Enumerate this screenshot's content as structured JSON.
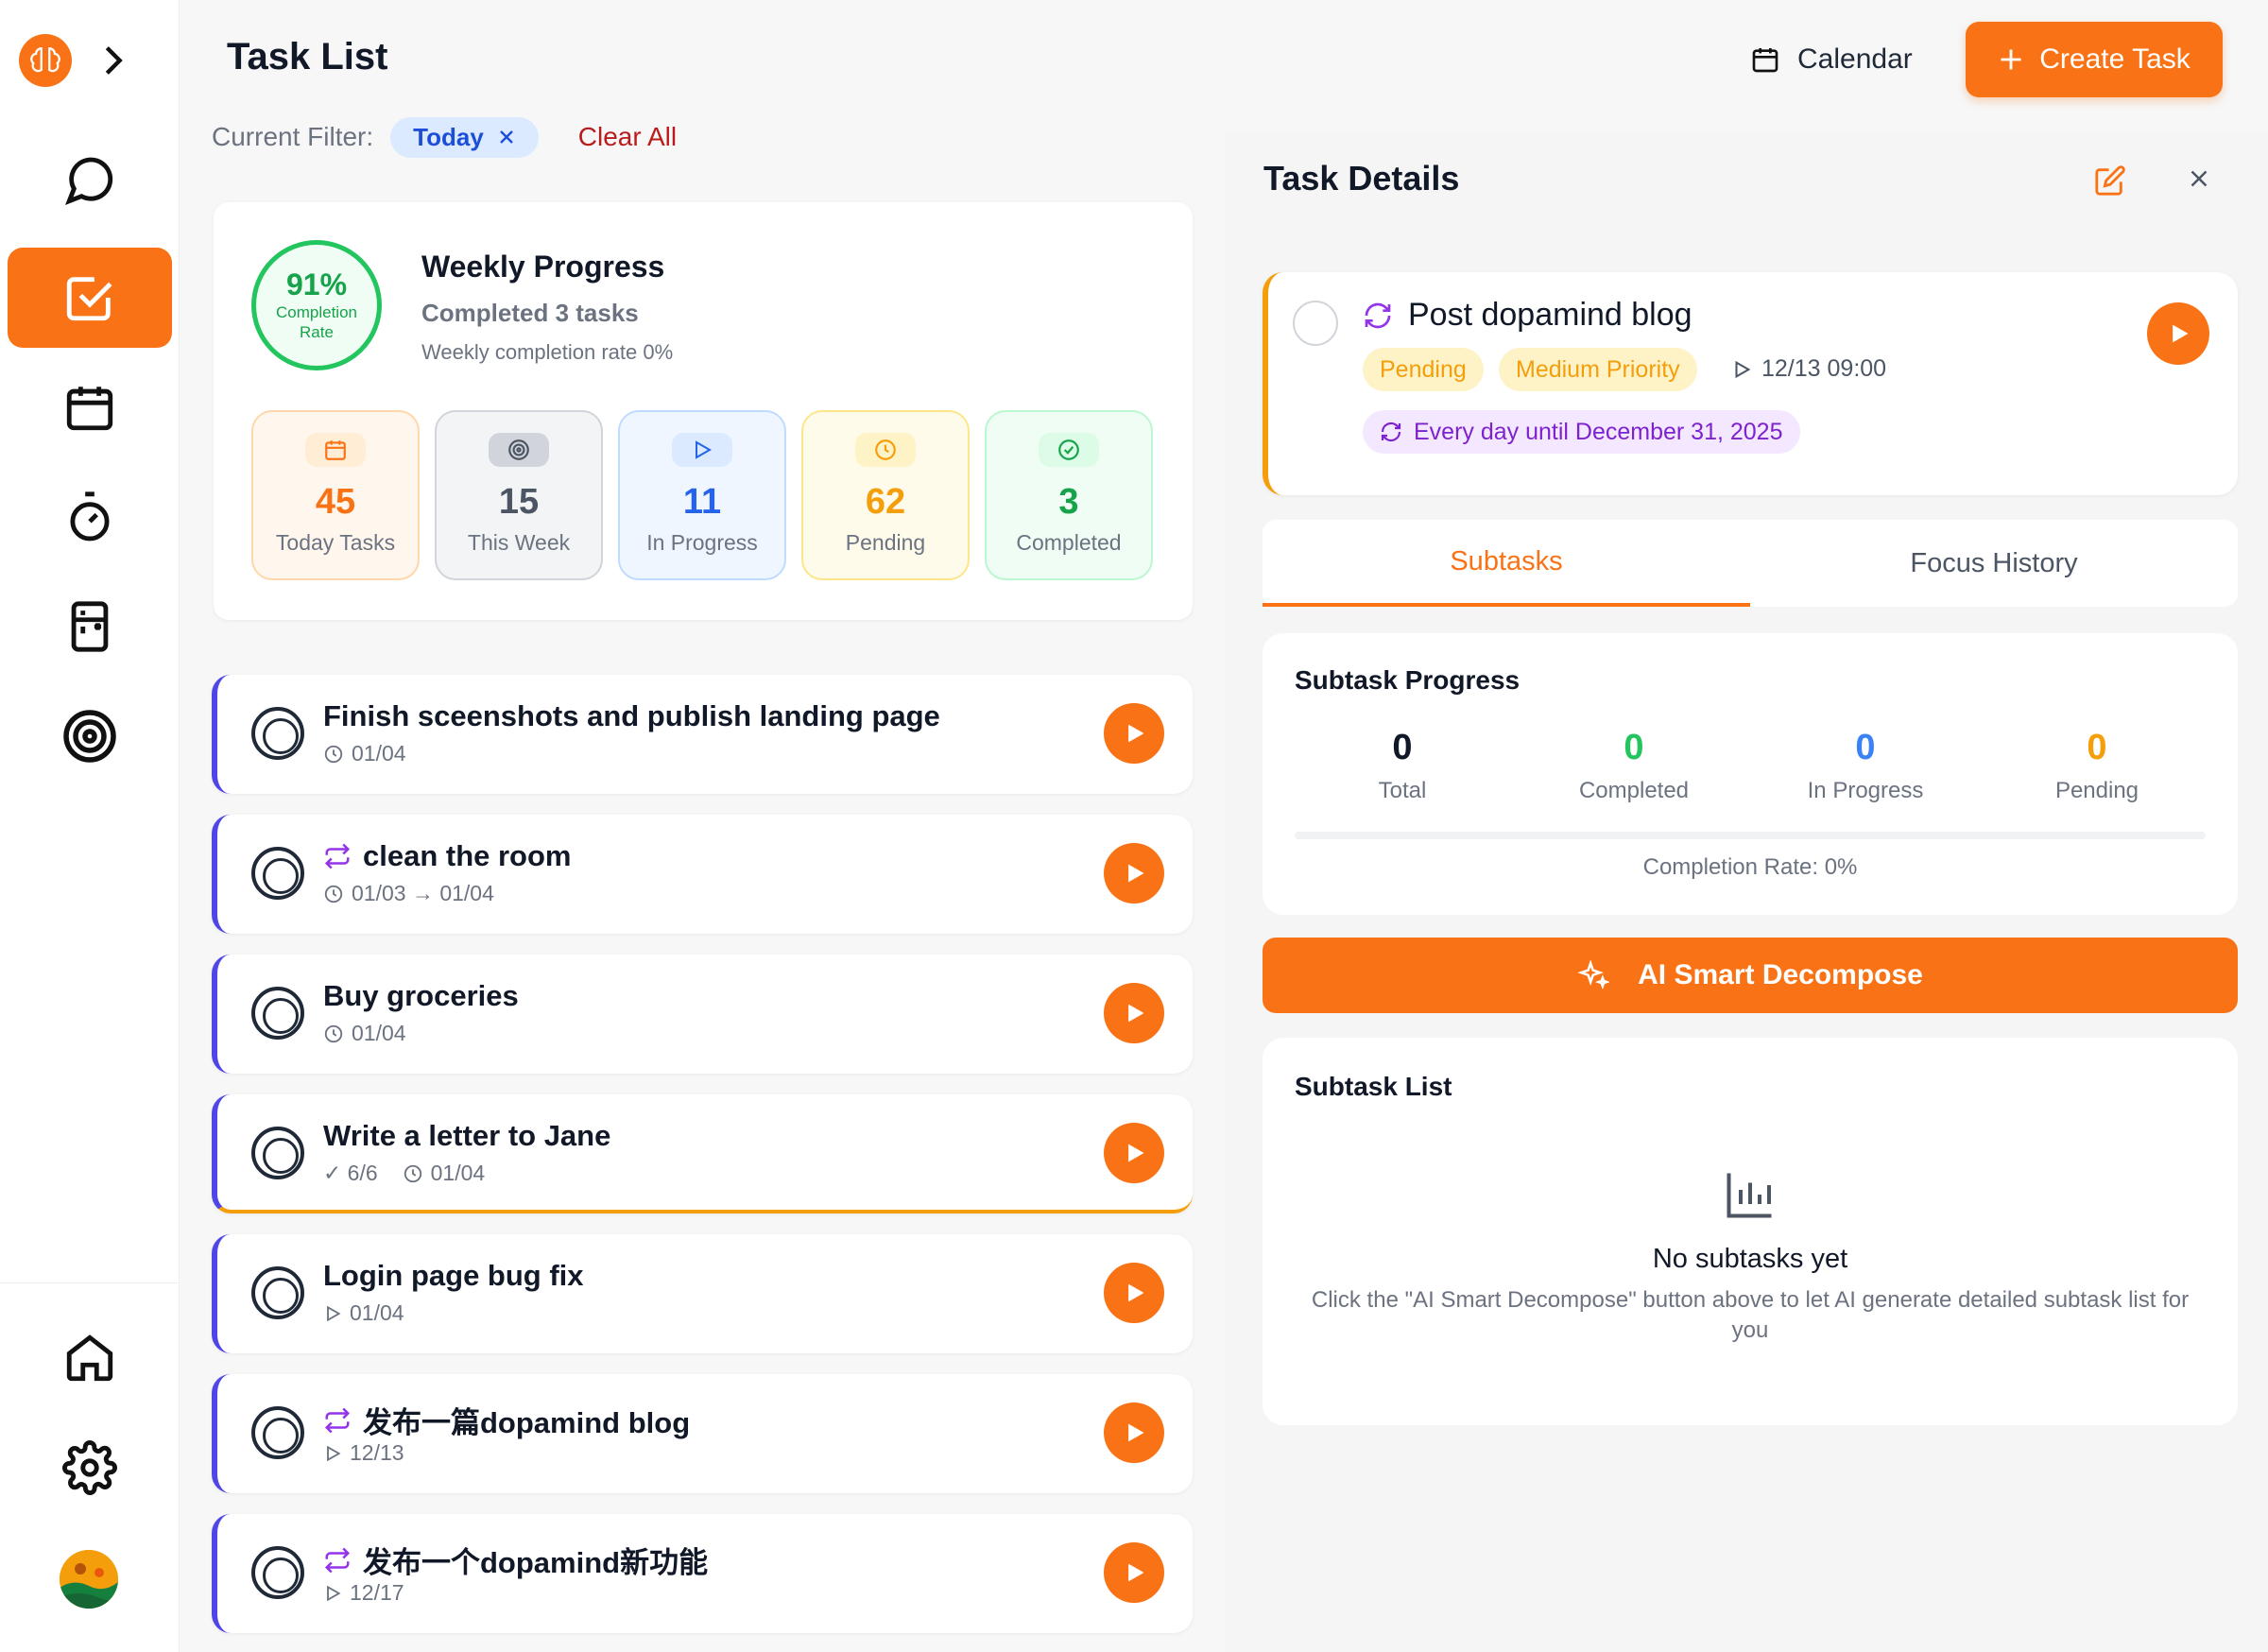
{
  "sidebar": {
    "items": [
      {
        "icon": "chat-icon"
      },
      {
        "icon": "checkbox-icon",
        "active": true
      },
      {
        "icon": "calendar-icon"
      },
      {
        "icon": "stopwatch-icon"
      },
      {
        "icon": "fridge-icon"
      },
      {
        "icon": "target-icon"
      }
    ],
    "bottom": [
      {
        "icon": "home-icon"
      },
      {
        "icon": "settings-icon"
      }
    ]
  },
  "header": {
    "title": "Task List",
    "calendar_label": "Calendar",
    "create_label": "Create Task"
  },
  "filter": {
    "label": "Current Filter:",
    "chip": "Today",
    "clear_label": "Clear All"
  },
  "weekly": {
    "percent": "91%",
    "ring_label": "Completion Rate",
    "title": "Weekly Progress",
    "subtitle": "Completed 3 tasks",
    "rate_text": "Weekly completion rate 0%",
    "stats": [
      {
        "value": "45",
        "label": "Today Tasks",
        "color": "#f97316"
      },
      {
        "value": "15",
        "label": "This Week",
        "color": "#4b5563"
      },
      {
        "value": "11",
        "label": "In Progress",
        "color": "#2563eb"
      },
      {
        "value": "62",
        "label": "Pending",
        "color": "#f59e0b"
      },
      {
        "value": "3",
        "label": "Completed",
        "color": "#16a34a"
      }
    ]
  },
  "tasks": [
    {
      "title": "Finish sceenshots and publish landing page",
      "meta": "01/04",
      "recurring": false
    },
    {
      "title": "clean the room",
      "meta": "01/03 → 01/04",
      "recurring": true
    },
    {
      "title": "Buy groceries",
      "meta": "01/04",
      "recurring": false
    },
    {
      "title": "Write a letter to Jane",
      "subtasks": "✓ 6/6",
      "meta": "01/04",
      "recurring": false
    },
    {
      "title": "Login page bug fix",
      "meta": "01/04",
      "recurring": false
    },
    {
      "title": "发布一篇dopamind blog",
      "meta": "12/13",
      "recurring": true
    },
    {
      "title": "发布一个dopamind新功能",
      "meta": "12/17",
      "recurring": true
    }
  ],
  "details": {
    "header": "Task Details",
    "task_title": "Post dopamind blog",
    "status": "Pending",
    "priority": "Medium Priority",
    "time": "12/13 09:00",
    "recurrence": "Every day until December 31, 2025",
    "tabs": [
      "Subtasks",
      "Focus History"
    ],
    "progress": {
      "title": "Subtask Progress",
      "stats": [
        {
          "value": "0",
          "label": "Total",
          "color": "#111827"
        },
        {
          "value": "0",
          "label": "Completed",
          "color": "#22c55e"
        },
        {
          "value": "0",
          "label": "In Progress",
          "color": "#3b82f6"
        },
        {
          "value": "0",
          "label": "Pending",
          "color": "#f59e0b"
        }
      ],
      "rate": "Completion Rate: 0%"
    },
    "ai_label": "AI Smart Decompose",
    "list": {
      "title": "Subtask List",
      "empty": "No subtasks yet",
      "hint": "Click the \"AI Smart Decompose\" button above to let AI generate detailed subtask list for you"
    }
  },
  "colors": {
    "accent": "#f97316",
    "task_border": "#4f46e5"
  }
}
